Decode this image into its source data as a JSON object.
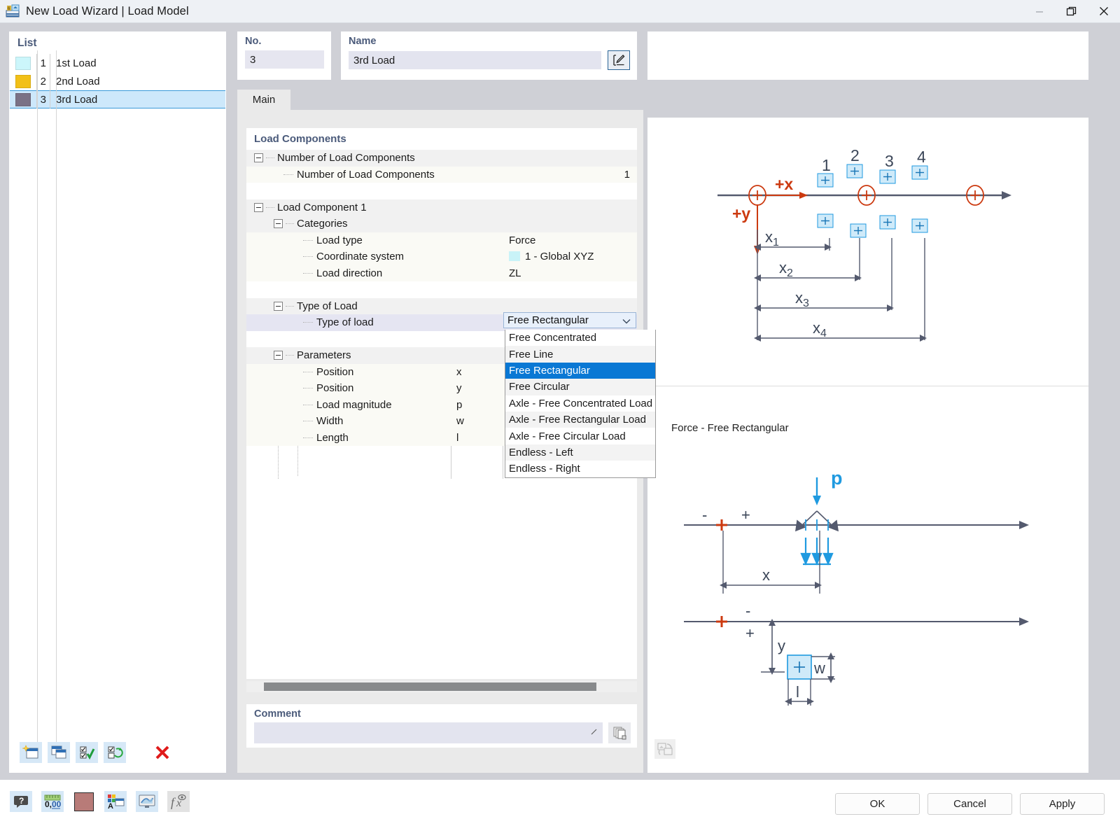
{
  "window": {
    "title": "New Load Wizard | Load Model",
    "app_icon": "load-wizard-icon",
    "minimize": "minimize-icon",
    "restore": "restore-icon",
    "close": "close-icon"
  },
  "list_panel": {
    "header": "List",
    "items": [
      {
        "no": "1",
        "name": "1st Load",
        "color": "#ccf6fb",
        "selected": false
      },
      {
        "no": "2",
        "name": "2nd Load",
        "color": "#f2c017",
        "selected": false
      },
      {
        "no": "3",
        "name": "3rd Load",
        "color": "#7a7286",
        "selected": true
      }
    ],
    "toolbar": [
      {
        "name": "new-load-button",
        "icon": "new-window-star-icon"
      },
      {
        "name": "copy-load-button",
        "icon": "copy-windows-icon"
      },
      {
        "name": "select-all-button",
        "icon": "checklist-check-icon"
      },
      {
        "name": "invert-selection-button",
        "icon": "checklist-refresh-icon"
      },
      {
        "name": "delete-load-button",
        "icon": "red-x-icon"
      }
    ]
  },
  "no_field": {
    "label": "No.",
    "value": "3"
  },
  "name_field": {
    "label": "Name",
    "value": "3rd Load",
    "edit_button_icon": "rename-pencil-icon"
  },
  "tabs": [
    {
      "label": "Main",
      "active": true
    }
  ],
  "tree": {
    "title": "Load Components",
    "rows": [
      {
        "type": "group",
        "indent": 0,
        "label": "Number of Load Components",
        "expander": "minus",
        "value": ""
      },
      {
        "type": "leaf",
        "indent": 1,
        "label": "Number of Load Components",
        "symbol": "",
        "value_right": "1"
      },
      {
        "type": "blank",
        "indent": 0,
        "label": "",
        "value": ""
      },
      {
        "type": "group",
        "indent": 0,
        "label": "Load Component 1",
        "expander": "minus",
        "value": ""
      },
      {
        "type": "group2",
        "indent": 1,
        "label": "Categories",
        "expander": "minus",
        "value": ""
      },
      {
        "type": "leaf",
        "indent": 2,
        "label": "Load type",
        "symbol": "",
        "value_main": "Force"
      },
      {
        "type": "leaf",
        "indent": 2,
        "label": "Coordinate system",
        "symbol": "",
        "value_main": "1 - Global XYZ",
        "swatch": "#c9f3f8"
      },
      {
        "type": "leaf",
        "indent": 2,
        "label": "Load direction",
        "symbol": "",
        "value_main": "ZL"
      },
      {
        "type": "blank",
        "indent": 0,
        "label": "",
        "value": ""
      },
      {
        "type": "group2",
        "indent": 1,
        "label": "Type of Load",
        "expander": "minus",
        "value": ""
      },
      {
        "type": "selected",
        "indent": 2,
        "label": "Type of load",
        "symbol": "",
        "value_main": ""
      },
      {
        "type": "blank",
        "indent": 0,
        "label": "",
        "value": ""
      },
      {
        "type": "group2",
        "indent": 1,
        "label": "Parameters",
        "expander": "minus",
        "value": ""
      },
      {
        "type": "leaf",
        "indent": 2,
        "label": "Position",
        "symbol": "x",
        "value_main": ""
      },
      {
        "type": "leaf",
        "indent": 2,
        "label": "Position",
        "symbol": "y",
        "value_main": ""
      },
      {
        "type": "leaf",
        "indent": 2,
        "label": "Load magnitude",
        "symbol": "p",
        "value_main": ""
      },
      {
        "type": "leaf",
        "indent": 2,
        "label": "Width",
        "symbol": "w",
        "value_main": ""
      },
      {
        "type": "leaf",
        "indent": 2,
        "label": "Length",
        "symbol": "l",
        "value_main": ""
      }
    ]
  },
  "type_of_load_combo": {
    "value": "Free Rectangular",
    "chevron": "chevron-down-icon",
    "options": [
      {
        "label": "Free Concentrated",
        "selected": false
      },
      {
        "label": "Free Line",
        "selected": false
      },
      {
        "label": "Free Rectangular",
        "selected": true
      },
      {
        "label": "Free Circular",
        "selected": false
      },
      {
        "label": "Axle - Free Concentrated Load",
        "selected": false
      },
      {
        "label": "Axle - Free Rectangular Load",
        "selected": false
      },
      {
        "label": "Axle - Free Circular Load",
        "selected": false
      },
      {
        "label": "Endless - Left",
        "selected": false
      },
      {
        "label": "Endless - Right",
        "selected": false
      }
    ]
  },
  "comment": {
    "label": "Comment",
    "value": "",
    "expand_icon": "resize-handle-icon",
    "button_icon": "copy-pages-icon"
  },
  "diagram": {
    "caption": "Force - Free Rectangular",
    "axis_labels": {
      "x": "+x",
      "y": "+y"
    },
    "node_numbers": [
      "1",
      "2",
      "3",
      "4"
    ],
    "dimension_labels": [
      "x1",
      "x2",
      "x3",
      "x4"
    ],
    "detail_labels": {
      "p": "p",
      "x": "x",
      "y": "y",
      "w": "w",
      "l": "l",
      "minus": "-",
      "plus": "+"
    },
    "refresh_icon": "diagram-refresh-icon",
    "colors": {
      "accent_red": "#cc3a10",
      "accent_blue": "#1f9ae0",
      "line": "#545a6e"
    }
  },
  "bottom_toolbar": [
    {
      "name": "help-button",
      "icon": "question-bubble-icon"
    },
    {
      "name": "units-button",
      "icon": "decimal-ruler-icon"
    },
    {
      "name": "color-button",
      "icon": "color-swatch-icon",
      "color": "#b87b78"
    },
    {
      "name": "display-properties-button",
      "icon": "palette-window-icon"
    },
    {
      "name": "visualization-button",
      "icon": "monitor-icon"
    },
    {
      "name": "formula-button",
      "icon": "fx-eye-icon"
    }
  ],
  "dialog_buttons": [
    {
      "label": "OK",
      "name": "ok-button"
    },
    {
      "label": "Cancel",
      "name": "cancel-button"
    },
    {
      "label": "Apply",
      "name": "apply-button"
    }
  ]
}
